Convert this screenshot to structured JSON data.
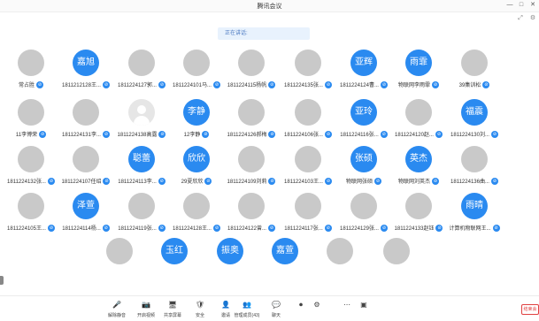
{
  "window": {
    "title": "腾讯会议",
    "controls": [
      "—",
      "□",
      "✕"
    ],
    "sub_controls": [
      "⤢",
      "⚙"
    ]
  },
  "speaking": {
    "text": "正在讲话:"
  },
  "participants": [
    [
      {
        "name": "常占胜",
        "avatar": "photo-a"
      },
      {
        "name": "1811212128王...",
        "avatar_text": "嘉旭"
      },
      {
        "name": "1811224127郭...",
        "avatar": "photo-b"
      },
      {
        "name": "1811224101马...",
        "avatar": "photo-c"
      },
      {
        "name": "1811224115杨帆",
        "avatar": "photo-d"
      },
      {
        "name": "1811224135张...",
        "avatar": "photo-e"
      },
      {
        "name": "1811224124曹...",
        "avatar_text": "亚辉"
      },
      {
        "name": "物联网李雨霏",
        "avatar_text": "雨霏"
      },
      {
        "name": "39集训松",
        "avatar": "photo-f"
      }
    ],
    [
      {
        "name": "11李博荣",
        "avatar": "photo-g"
      },
      {
        "name": "1811224131李...",
        "avatar": "photo-h"
      },
      {
        "name": "1811224138高露",
        "avatar": "gray"
      },
      {
        "name": "12李静",
        "avatar_text": "李静"
      },
      {
        "name": "1811224126郝梅",
        "avatar": "photo-i"
      },
      {
        "name": "1811224106张...",
        "avatar": "photo-j"
      },
      {
        "name": "1811224116张...",
        "avatar_text": "亚玲"
      },
      {
        "name": "1811224120赵...",
        "avatar": "photo-d"
      },
      {
        "name": "1811224130刘...",
        "avatar_text": "福震"
      }
    ],
    [
      {
        "name": "1811224132张...",
        "avatar": "photo-g"
      },
      {
        "name": "1811224107任绍",
        "avatar": "photo-e"
      },
      {
        "name": "1811224113李...",
        "avatar_text": "聪蕾"
      },
      {
        "name": "29夏欣欣",
        "avatar_text": "欣欣"
      },
      {
        "name": "1811224109刘莉",
        "avatar": "photo-c"
      },
      {
        "name": "1811224103王...",
        "avatar": "photo-n"
      },
      {
        "name": "物联网张硕",
        "avatar_text": "张硕"
      },
      {
        "name": "物联网刘英杰",
        "avatar_text": "英杰"
      },
      {
        "name": "1811224136曲...",
        "avatar": "photo-i"
      }
    ],
    [
      {
        "name": "1811224105王...",
        "avatar": "photo-b"
      },
      {
        "name": "1811224114杨...",
        "avatar_text": "泽萱"
      },
      {
        "name": "1811224119张...",
        "avatar": "photo-c"
      },
      {
        "name": "1811224128王...",
        "avatar": "photo-j"
      },
      {
        "name": "1811224122曾...",
        "avatar": "photo-k"
      },
      {
        "name": "1811224117张...",
        "avatar": "photo-k"
      },
      {
        "name": "1811224129张...",
        "avatar": "photo-l"
      },
      {
        "name": "1811224133赵钰",
        "avatar": "photo-m"
      },
      {
        "name": "计算机物联网王...",
        "avatar_text": "雨晴"
      }
    ],
    [
      {
        "name": "",
        "avatar": "photo-n"
      },
      {
        "name": "",
        "avatar_text": "玉红"
      },
      {
        "name": "",
        "avatar_text": "振奥"
      },
      {
        "name": "",
        "avatar_text": "嘉萱"
      },
      {
        "name": "",
        "avatar": "photo-o"
      },
      {
        "name": "",
        "avatar": "photo-m"
      }
    ]
  ],
  "toolbar": {
    "items": [
      {
        "label": "解除静音",
        "icon": "🎤"
      },
      {
        "label": "开启视频",
        "icon": "📷"
      },
      {
        "label": "共享屏幕",
        "icon": "🖥"
      },
      {
        "label": "安全",
        "icon": "🛡"
      },
      {
        "label": "邀请",
        "icon": "👤"
      },
      {
        "label": "管理成员(43)",
        "icon": "👥"
      },
      {
        "label": "聊天",
        "icon": "💬"
      },
      {
        "label": "",
        "icon": "⏺"
      },
      {
        "label": "",
        "icon": "⚙"
      },
      {
        "label": "",
        "icon": "⋯"
      },
      {
        "label": "",
        "icon": "▣"
      }
    ],
    "end_label": "结束会议"
  }
}
